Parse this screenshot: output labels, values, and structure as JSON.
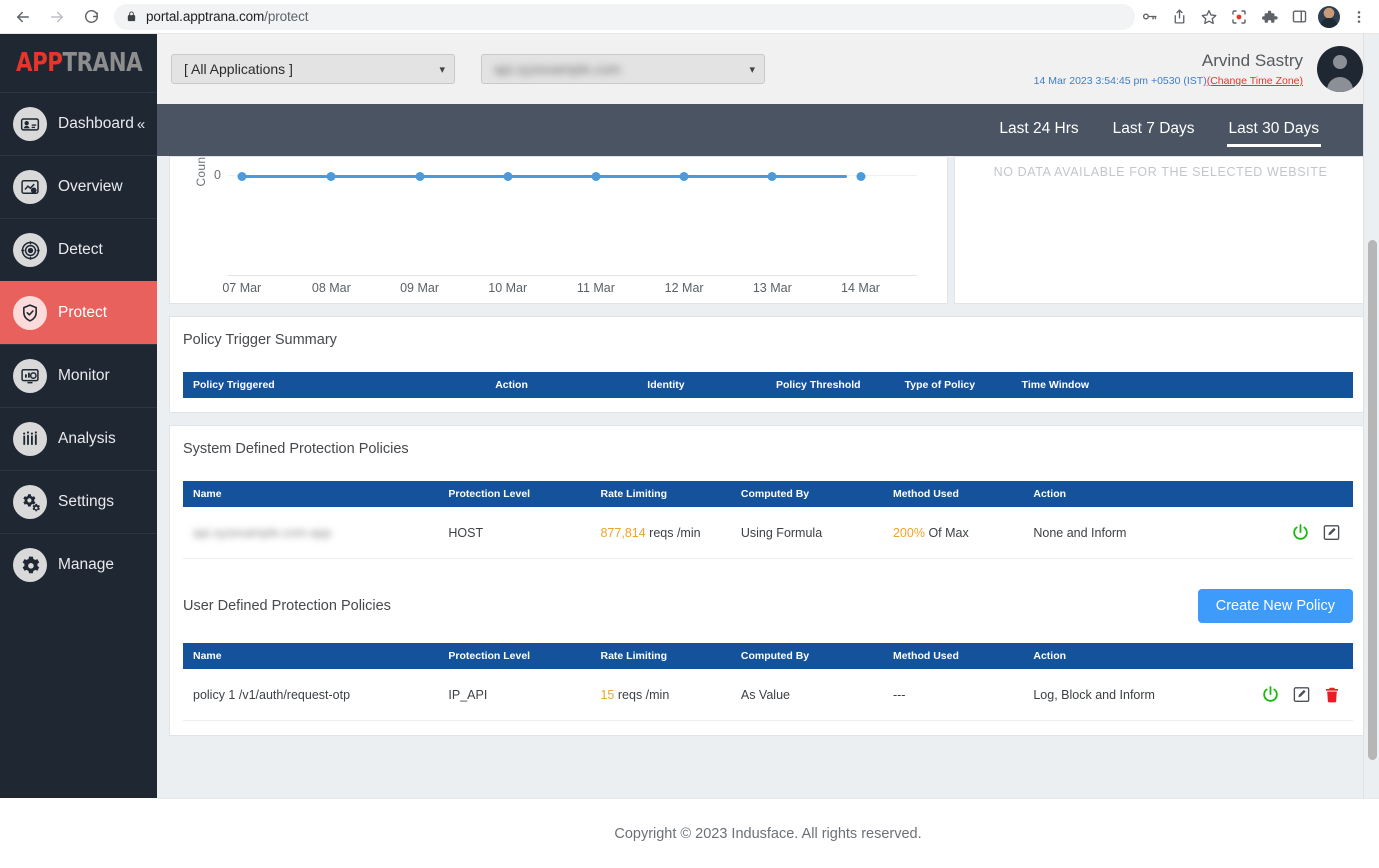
{
  "browser": {
    "url_host": "portal.apptrana.com",
    "url_path": "/protect",
    "back_icon": "back-arrow-icon",
    "forward_icon": "forward-arrow-icon",
    "reload_icon": "reload-icon",
    "lock_icon": "lock-icon",
    "toolbar_icons": [
      "key-icon",
      "share-icon",
      "bookmark-star-icon",
      "screen-capture-icon",
      "extensions-puzzle-icon",
      "side-panel-icon",
      "profile-avatar",
      "three-dot-menu-icon"
    ]
  },
  "sidebar": {
    "logo_part1": "APP",
    "logo_part2": "TRANA",
    "collapse_glyph": "«",
    "items": [
      {
        "label": "Dashboard",
        "icon": "dashboard-icon",
        "active": false,
        "collapse": true
      },
      {
        "label": "Overview",
        "icon": "overview-icon",
        "active": false
      },
      {
        "label": "Detect",
        "icon": "detect-target-icon",
        "active": false
      },
      {
        "label": "Protect",
        "icon": "shield-check-icon",
        "active": true
      },
      {
        "label": "Monitor",
        "icon": "monitor-icon",
        "active": false
      },
      {
        "label": "Analysis",
        "icon": "analysis-bars-icon",
        "active": false
      },
      {
        "label": "Settings",
        "icon": "gears-icon",
        "active": false
      },
      {
        "label": "Manage",
        "icon": "gear-icon",
        "active": false
      }
    ]
  },
  "topbar": {
    "application_select": {
      "value": "[ All Applications ]",
      "caret": "chevron-down-icon"
    },
    "site_select": {
      "value": "api.xyzexample.com",
      "redacted": true,
      "caret": "chevron-down-icon"
    },
    "user_name": "Arvind Sastry",
    "timestamp": "14 Mar 2023 3:54:45 pm +0530 (IST)",
    "timezone_link": "(Change Time Zone)",
    "avatar": "user-avatar"
  },
  "period_tabs": [
    {
      "label": "Last 24 Hrs",
      "active": false
    },
    {
      "label": "Last 7 Days",
      "active": false
    },
    {
      "label": "Last 30 Days",
      "active": true
    }
  ],
  "no_data_panel": {
    "message": "NO DATA AVAILABLE FOR THE SELECTED WEBSITE"
  },
  "chart_data": {
    "type": "line",
    "title": "",
    "xlabel": "",
    "ylabel": "Count",
    "categories": [
      "07 Mar",
      "08 Mar",
      "09 Mar",
      "10 Mar",
      "11 Mar",
      "12 Mar",
      "13 Mar",
      "14 Mar"
    ],
    "values": [
      0,
      0,
      0,
      0,
      0,
      0,
      0,
      0
    ],
    "yticks": [
      "0"
    ],
    "ylim": [
      0,
      0
    ],
    "grid": false,
    "legend": "none",
    "series_color": "#4a9ae0"
  },
  "policy_trigger_summary": {
    "title": "Policy Trigger Summary",
    "columns": [
      "Policy Triggered",
      "Action",
      "Identity",
      "Policy Threshold",
      "Type of Policy",
      "Time Window"
    ],
    "rows": []
  },
  "system_policies": {
    "title": "System Defined Protection Policies",
    "columns": [
      "Name",
      "Protection Level",
      "Rate Limiting",
      "Computed By",
      "Method Used",
      "Action"
    ],
    "rows": [
      {
        "name": "api.xyzexample.com-app",
        "name_redacted": true,
        "protection_level": "HOST",
        "rate_value": "877,814",
        "rate_unit": "reqs /min",
        "computed_by": "Using Formula",
        "method_value": "200%",
        "method_suffix": "Of Max",
        "action": "None and Inform",
        "icons": [
          "power-toggle-icon",
          "edit-icon"
        ]
      }
    ]
  },
  "user_policies": {
    "title": "User Defined Protection Policies",
    "create_button": "Create New Policy",
    "columns": [
      "Name",
      "Protection Level",
      "Rate Limiting",
      "Computed By",
      "Method Used",
      "Action"
    ],
    "rows": [
      {
        "name": "policy 1 /v1/auth/request-otp",
        "name_redacted": false,
        "protection_level": "IP_API",
        "rate_value": "15",
        "rate_unit": "reqs /min",
        "computed_by": "As Value",
        "method_value": "",
        "method_suffix": "---",
        "action": "Log, Block and Inform",
        "icons": [
          "power-toggle-icon",
          "edit-icon",
          "delete-trash-icon"
        ]
      }
    ]
  },
  "footer": {
    "copyright": "Copyright © 2023 Indusface. All rights reserved."
  },
  "colors": {
    "sidebar_bg": "#1f2733",
    "active_nav": "#e8615c",
    "table_header": "#14529b",
    "accent_blue": "#3d9bfc",
    "amber": "#f0a32a",
    "power_green": "#1db812",
    "delete_red": "#ec1c24",
    "brand_red": "#e8352a"
  }
}
